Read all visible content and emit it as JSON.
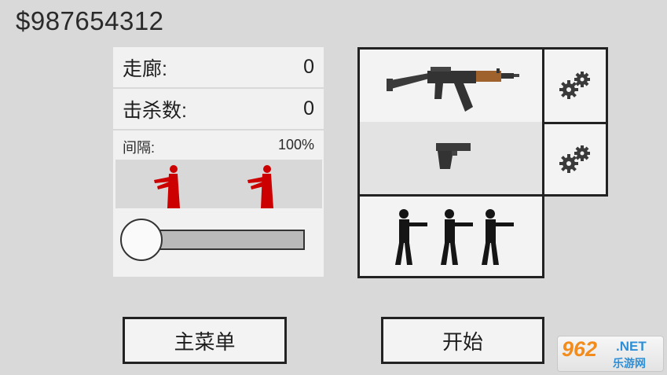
{
  "hud": {
    "money": "$987654312"
  },
  "stats": {
    "corridor_label": "走廊:",
    "corridor_value": "0",
    "kills_label": "击杀数:",
    "kills_value": "0"
  },
  "interval": {
    "label": "间隔:",
    "value": "100%",
    "slider_level": 0
  },
  "loadout": {
    "primary_weapon": "rifle-icon",
    "secondary_weapon": "pistol-icon",
    "squad": "soldier-squad-icon",
    "settings_icon": "gears-icon"
  },
  "buttons": {
    "main_menu": "主菜单",
    "start": "开始"
  },
  "watermark": {
    "number": "962",
    "domain": ".NET",
    "site": "乐游网"
  },
  "colors": {
    "background": "#d9d9d9",
    "panel": "#f1f1f1",
    "border": "#222222",
    "target_red": "#cc0000",
    "rifle_wood": "#a0622d"
  }
}
